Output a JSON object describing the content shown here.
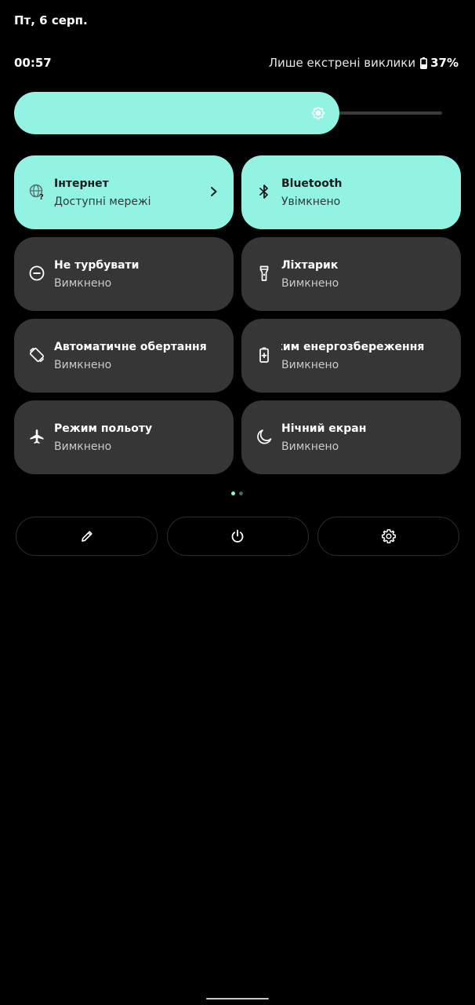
{
  "header": {
    "date": "Пт, 6 серп.",
    "time": "00:57",
    "network_status": "Лише екстрені виклики",
    "battery_percent": "37%",
    "battery_icon": "battery-icon"
  },
  "brightness": {
    "level": 0.76,
    "icon": "brightness-icon"
  },
  "colors": {
    "accent": "#93f3e3",
    "tile_inactive": "#363636",
    "background": "#000000"
  },
  "tiles": [
    {
      "title": "Інтернет",
      "subtitle": "Доступні мережі",
      "icon": "internet-globe-icon",
      "active": true
    },
    {
      "title": "Bluetooth",
      "subtitle": "Увімкнено",
      "icon": "bluetooth-icon",
      "active": true
    },
    {
      "title": "Не турбувати",
      "subtitle": "Вимкнено",
      "icon": "do-not-disturb-icon",
      "active": false
    },
    {
      "title": "Ліхтарик",
      "subtitle": "Вимкнено",
      "icon": "flashlight-icon",
      "active": false
    },
    {
      "title": "Автоматичне обертання",
      "subtitle": "Вимкнено",
      "icon": "auto-rotate-icon",
      "active": false
    },
    {
      "title": "жим енергозбереження",
      "subtitle": "Вимкнено",
      "icon": "battery-saver-icon",
      "active": false
    },
    {
      "title": "Режим польоту",
      "subtitle": "Вимкнено",
      "icon": "airplane-icon",
      "active": false
    },
    {
      "title": "Нічний екран",
      "subtitle": "Вимкнено",
      "icon": "night-light-icon",
      "active": false
    }
  ],
  "pager": {
    "current_page": 1,
    "total_pages": 2
  },
  "actions": [
    {
      "icon": "edit-pencil-icon"
    },
    {
      "icon": "power-icon"
    },
    {
      "icon": "settings-gear-icon"
    }
  ]
}
